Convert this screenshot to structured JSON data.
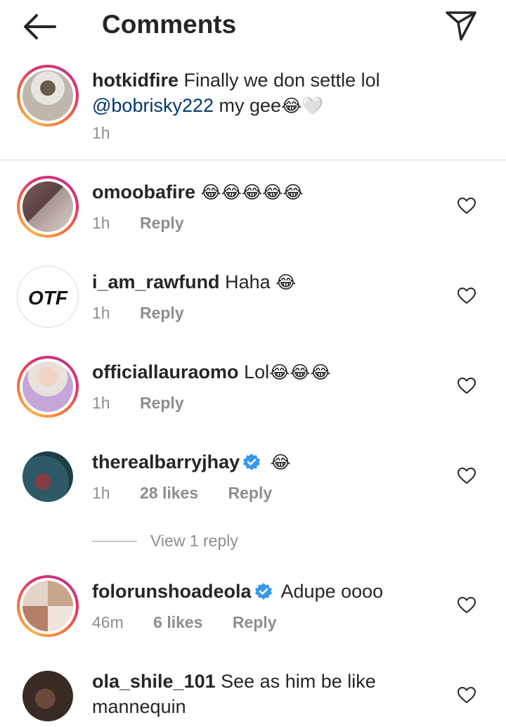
{
  "header": {
    "title": "Comments",
    "back_icon": "arrow-left-icon",
    "share_icon": "paper-plane-icon"
  },
  "caption": {
    "username": "hotkidfire",
    "text": "Finally we don settle lol",
    "mention": "@bobrisky222",
    "text2": "my gee",
    "emojis": "😂🤍",
    "time": "1h"
  },
  "comments": [
    {
      "username": "omoobafire",
      "text": "",
      "emojis": "😂😂😂😂😂",
      "time": "1h",
      "likes": "",
      "reply": "Reply"
    },
    {
      "username": "i_am_rawfund",
      "text": "Haha",
      "emojis": "😂",
      "time": "1h",
      "likes": "",
      "reply": "Reply"
    },
    {
      "username": "officiallauraomo",
      "text": "Lol",
      "emojis": "😂😂😂",
      "time": "1h",
      "likes": "",
      "reply": "Reply"
    },
    {
      "username": "therealbarryjhay",
      "text": "",
      "emojis": "😂",
      "time": "1h",
      "likes": "28 likes",
      "reply": "Reply",
      "verified": true
    },
    {
      "username": "folorunshoadeola",
      "text": "Adupe oooo",
      "emojis": "",
      "time": "46m",
      "likes": "6 likes",
      "reply": "Reply",
      "verified": true
    },
    {
      "username": "ola_shile_101",
      "text": "See as him be like mannequin",
      "emojis": "",
      "time": "",
      "likes": "",
      "reply": ""
    }
  ],
  "view_replies": "View 1 reply",
  "colors": {
    "mention": "#00376b",
    "verified": "#3897f0",
    "meta": "#8e8e8e",
    "ring_start": "#fcaf45",
    "ring_end": "#c13584"
  }
}
